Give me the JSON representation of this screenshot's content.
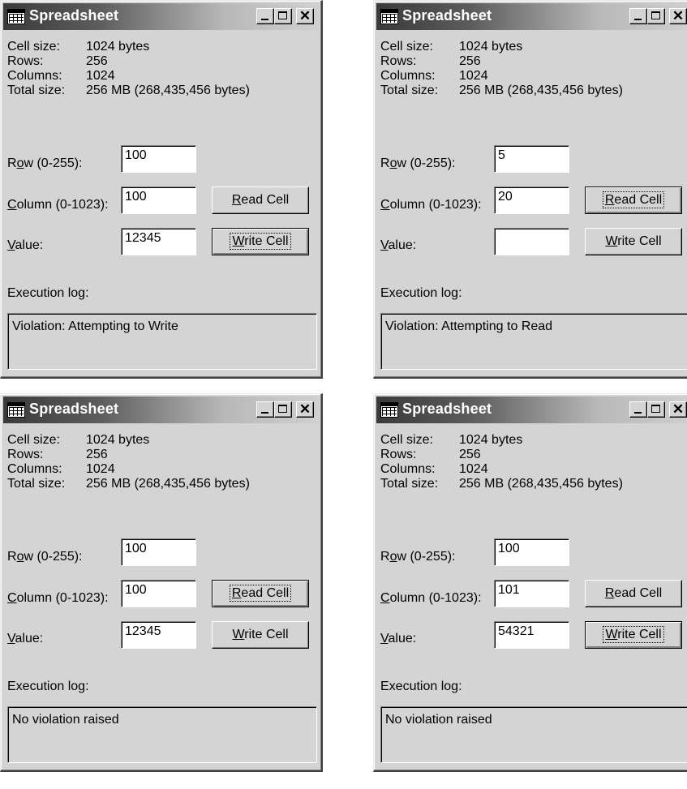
{
  "windows": [
    {
      "title": "Spreadsheet",
      "info": [
        {
          "key": "Cell size:",
          "value": "1024 bytes"
        },
        {
          "key": "Rows:",
          "value": "256"
        },
        {
          "key": "Columns:",
          "value": "1024"
        },
        {
          "key": "Total size:",
          "value": "256 MB (268,435,456 bytes)"
        }
      ],
      "row_label": {
        "pre": "R",
        "mn": "o",
        "post": "w (0-255):"
      },
      "column_label": {
        "pre": "",
        "mn": "C",
        "post": "olumn (0-1023):"
      },
      "value_label": {
        "pre": "",
        "mn": "V",
        "post": "alue:"
      },
      "row_value": "100",
      "column_value": "100",
      "value_value": "12345",
      "read_button": {
        "mn": "R",
        "rest": "ead Cell"
      },
      "write_button": {
        "mn": "W",
        "rest": "rite Cell"
      },
      "focused_button": "write",
      "log_label": {
        "pre": "Execution lo",
        "mn": "g",
        "post": ":"
      },
      "log_text": "Violation: Attempting to Write"
    },
    {
      "title": "Spreadsheet",
      "info": [
        {
          "key": "Cell size:",
          "value": "1024 bytes"
        },
        {
          "key": "Rows:",
          "value": "256"
        },
        {
          "key": "Columns:",
          "value": "1024"
        },
        {
          "key": "Total size:",
          "value": "256 MB (268,435,456 bytes)"
        }
      ],
      "row_label": {
        "pre": "R",
        "mn": "o",
        "post": "w (0-255):"
      },
      "column_label": {
        "pre": "",
        "mn": "C",
        "post": "olumn (0-1023):"
      },
      "value_label": {
        "pre": "",
        "mn": "V",
        "post": "alue:"
      },
      "row_value": "5",
      "column_value": "20",
      "value_value": "",
      "read_button": {
        "mn": "R",
        "rest": "ead Cell"
      },
      "write_button": {
        "mn": "W",
        "rest": "rite Cell"
      },
      "focused_button": "read",
      "log_label": {
        "pre": "Execution lo",
        "mn": "g",
        "post": ":"
      },
      "log_text": "Violation: Attempting to Read"
    },
    {
      "title": "Spreadsheet",
      "info": [
        {
          "key": "Cell size:",
          "value": "1024 bytes"
        },
        {
          "key": "Rows:",
          "value": "256"
        },
        {
          "key": "Columns:",
          "value": "1024"
        },
        {
          "key": "Total size:",
          "value": "256 MB (268,435,456 bytes)"
        }
      ],
      "row_label": {
        "pre": "R",
        "mn": "o",
        "post": "w (0-255):"
      },
      "column_label": {
        "pre": "",
        "mn": "C",
        "post": "olumn (0-1023):"
      },
      "value_label": {
        "pre": "",
        "mn": "V",
        "post": "alue:"
      },
      "row_value": "100",
      "column_value": "100",
      "value_value": "12345",
      "read_button": {
        "mn": "R",
        "rest": "ead Cell"
      },
      "write_button": {
        "mn": "W",
        "rest": "rite Cell"
      },
      "focused_button": "read",
      "log_label": {
        "pre": "Execution lo",
        "mn": "g",
        "post": ":"
      },
      "log_text": "No violation raised"
    },
    {
      "title": "Spreadsheet",
      "info": [
        {
          "key": "Cell size:",
          "value": "1024 bytes"
        },
        {
          "key": "Rows:",
          "value": "256"
        },
        {
          "key": "Columns:",
          "value": "1024"
        },
        {
          "key": "Total size:",
          "value": "256 MB (268,435,456 bytes)"
        }
      ],
      "row_label": {
        "pre": "R",
        "mn": "o",
        "post": "w (0-255):"
      },
      "column_label": {
        "pre": "",
        "mn": "C",
        "post": "olumn (0-1023):"
      },
      "value_label": {
        "pre": "",
        "mn": "V",
        "post": "alue:"
      },
      "row_value": "100",
      "column_value": "101",
      "value_value": "54321",
      "read_button": {
        "mn": "R",
        "rest": "ead Cell"
      },
      "write_button": {
        "mn": "W",
        "rest": "rite Cell"
      },
      "focused_button": "write",
      "log_label": {
        "pre": "Execution lo",
        "mn": "g",
        "post": ":"
      },
      "log_text": "No violation raised"
    }
  ],
  "titlebar_icons": [
    "spreadsheet-icon",
    "minimize-icon",
    "maximize-icon",
    "close-icon"
  ],
  "colors": {
    "face": "#d4d4d4",
    "titlebar_dark": "#3a3a3a",
    "titlebar_light": "#d0d0d0"
  }
}
